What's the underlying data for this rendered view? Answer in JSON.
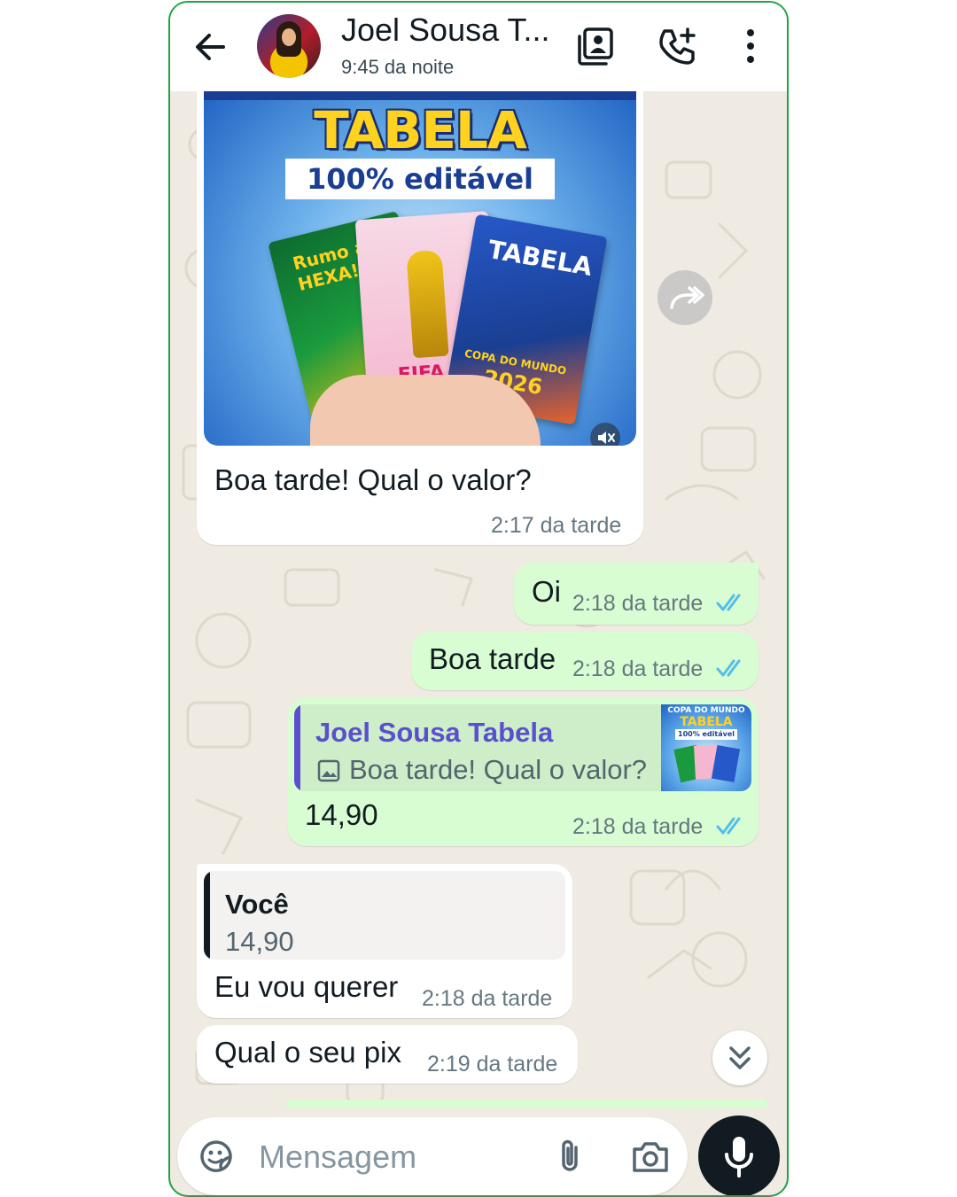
{
  "header": {
    "contact_name": "Joel Sousa T...",
    "status": "9:45 da noite",
    "icons": [
      "back-arrow-icon",
      "contact-card-icon",
      "add-call-icon",
      "more-vert-icon"
    ]
  },
  "messages": [
    {
      "direction": "incoming",
      "type": "image",
      "image_title": "TABELA",
      "image_subtitle": "100% editável",
      "image_cards": [
        "Rumo ao HEXA!",
        "FIFA",
        "TABELA",
        "COPA DO MUNDO",
        "2026"
      ],
      "text": "Boa tarde! Qual o valor?",
      "time": "2:17 da tarde"
    },
    {
      "direction": "outgoing",
      "text": "Oi",
      "time": "2:18 da tarde",
      "status": "read"
    },
    {
      "direction": "outgoing",
      "text": "Boa tarde",
      "time": "2:18 da tarde",
      "status": "read"
    },
    {
      "direction": "outgoing",
      "quote": {
        "author": "Joel Sousa Tabela",
        "text": "Boa tarde! Qual o valor?",
        "thumb_title": "COPA DO MUNDO",
        "thumb_sub": "TABELA",
        "thumb_caption": "100% editável"
      },
      "text": "14,90",
      "time": "2:18 da tarde",
      "status": "read"
    },
    {
      "direction": "incoming",
      "quote": {
        "author": "Você",
        "text": "14,90"
      },
      "text": "Eu vou querer",
      "time": "2:18 da tarde"
    },
    {
      "direction": "incoming",
      "text": "Qual o seu pix",
      "time": "2:19 da tarde"
    }
  ],
  "composer": {
    "placeholder": "Mensagem",
    "icons": [
      "sticker-icon",
      "attach-icon",
      "camera-icon",
      "mic-icon"
    ]
  },
  "colors": {
    "outgoing_bubble": "#d8fdd2",
    "incoming_bubble": "#ffffff",
    "read_ticks": "#53bdeb",
    "quote_bar_out": "#5a4fcf",
    "quote_bar_in": "#111b21",
    "frame_border": "#22a244",
    "wallpaper": "#efeae2"
  }
}
